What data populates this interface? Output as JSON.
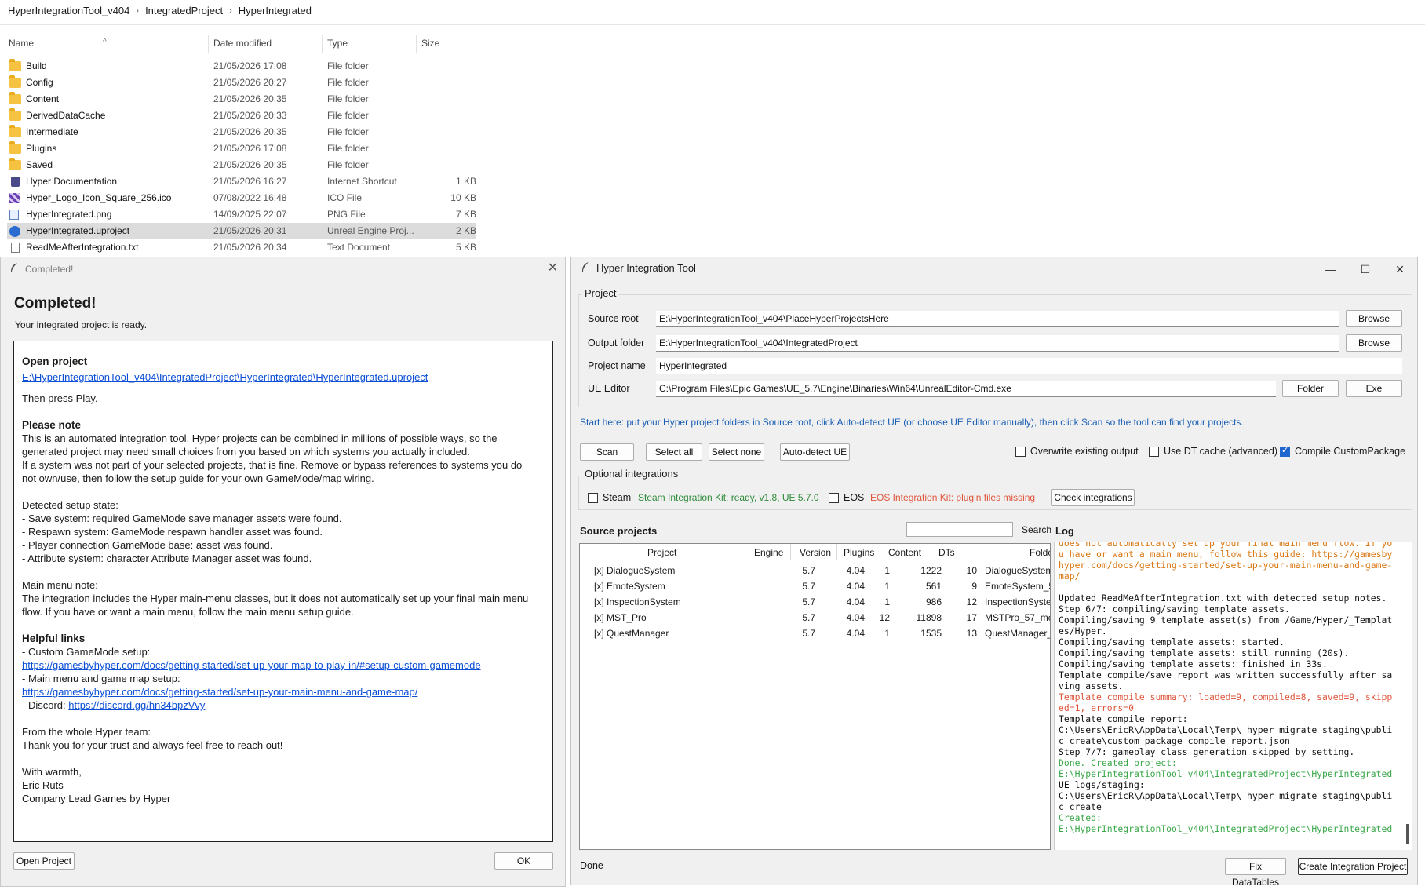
{
  "explorer": {
    "breadcrumb": [
      "HyperIntegrationTool_v404",
      "IntegratedProject",
      "HyperIntegrated"
    ],
    "columns": {
      "name": "Name",
      "date": "Date modified",
      "type": "Type",
      "size": "Size"
    },
    "files": [
      {
        "name": "Build",
        "date": "21/05/2026 17:08",
        "type": "File folder",
        "size": "",
        "icon": "folder-icon"
      },
      {
        "name": "Config",
        "date": "21/05/2026 20:27",
        "type": "File folder",
        "size": "",
        "icon": "folder-icon"
      },
      {
        "name": "Content",
        "date": "21/05/2026 20:35",
        "type": "File folder",
        "size": "",
        "icon": "folder-icon"
      },
      {
        "name": "DerivedDataCache",
        "date": "21/05/2026 20:33",
        "type": "File folder",
        "size": "",
        "icon": "folder-icon"
      },
      {
        "name": "Intermediate",
        "date": "21/05/2026 20:35",
        "type": "File folder",
        "size": "",
        "icon": "folder-icon"
      },
      {
        "name": "Plugins",
        "date": "21/05/2026 17:08",
        "type": "File folder",
        "size": "",
        "icon": "folder-icon"
      },
      {
        "name": "Saved",
        "date": "21/05/2026 20:35",
        "type": "File folder",
        "size": "",
        "icon": "folder-icon"
      },
      {
        "name": "Hyper Documentation",
        "date": "21/05/2026 16:27",
        "type": "Internet Shortcut",
        "size": "1 KB",
        "icon": "shortcut-icon"
      },
      {
        "name": "Hyper_Logo_Icon_Square_256.ico",
        "date": "07/08/2022 16:48",
        "type": "ICO File",
        "size": "10 KB",
        "icon": "ico-file-icon"
      },
      {
        "name": "HyperIntegrated.png",
        "date": "14/09/2025 22:07",
        "type": "PNG File",
        "size": "7 KB",
        "icon": "image-file-icon"
      },
      {
        "name": "HyperIntegrated.uproject",
        "date": "21/05/2026 20:31",
        "type": "Unreal Engine Proj...",
        "size": "2 KB",
        "icon": "unreal-project-icon"
      },
      {
        "name": "ReadMeAfterIntegration.txt",
        "date": "21/05/2026 20:34",
        "type": "Text Document",
        "size": "5 KB",
        "icon": "text-file-icon"
      }
    ]
  },
  "dialog": {
    "title": "Completed!",
    "heading": "Completed!",
    "subtitle": "Your integrated project is ready.",
    "open_project_heading": "Open project",
    "project_link": "E:\\HyperIntegrationTool_v404\\IntegratedProject\\HyperIntegrated\\HyperIntegrated.uproject",
    "then_press": "Then press Play.",
    "note_heading": "Please note",
    "note_lines": [
      "This is an automated integration tool. Hyper projects can be combined in millions of possible ways, so the",
      "generated project may need small choices from you based on which systems you actually included.",
      "If a system was not part of your selected projects, that is fine. Remove or bypass references to systems you do",
      "not own/use, then follow the setup guide for your own GameMode/map wiring."
    ],
    "detected_heading": "Detected setup state:",
    "detected_lines": [
      "- Save system: required GameMode save manager assets were found.",
      "- Respawn system: GameMode respawn handler asset was found.",
      "- Player connection GameMode base: asset was found.",
      "- Attribute system: character Attribute Manager asset was found."
    ],
    "menu_heading": "Main menu note:",
    "menu_lines": [
      "The integration includes the Hyper main-menu classes, but it does not automatically set up your final main menu",
      "flow. If you have or want a main menu, follow the main menu setup guide."
    ],
    "links_heading": "Helpful links",
    "link1_label": "- Custom GameMode setup:",
    "link1": "https://gamesbyhyper.com/docs/getting-started/set-up-your-map-to-play-in/#setup-custom-gamemode",
    "link2_label": "- Main menu and game map setup:",
    "link2": "https://gamesbyhyper.com/docs/getting-started/set-up-your-main-menu-and-game-map/",
    "discord_label": "- Discord: ",
    "discord": "https://discord.gg/hn34bpzVvy",
    "team_lines": [
      "From the whole Hyper team:",
      "Thank you for your trust and always feel free to reach out!"
    ],
    "sign_lines": [
      "With warmth,",
      "Eric Ruts",
      "Company Lead Games by Hyper"
    ],
    "open_button": "Open Project",
    "ok_button": "OK"
  },
  "tool": {
    "title": "Hyper Integration Tool",
    "project_group": "Project",
    "source_root_label": "Source root",
    "source_root": "E:\\HyperIntegrationTool_v404\\PlaceHyperProjectsHere",
    "output_folder_label": "Output folder",
    "output_folder": "E:\\HyperIntegrationTool_v404\\IntegratedProject",
    "project_name_label": "Project name",
    "project_name": "HyperIntegrated",
    "ue_editor_label": "UE Editor",
    "ue_editor": "C:\\Program Files\\Epic Games\\UE_5.7\\Engine\\Binaries\\Win64\\UnrealEditor-Cmd.exe",
    "browse": "Browse",
    "folder": "Folder",
    "exe": "Exe",
    "hint": "Start here: put your Hyper project folders in Source root, click Auto-detect UE (or choose UE Editor manually), then click Scan so the tool can find your projects.",
    "scan": "Scan",
    "select_all": "Select all",
    "select_none": "Select none",
    "auto_detect": "Auto-detect UE",
    "overwrite": "Overwrite existing output",
    "use_dt_cache": "Use DT cache (advanced)",
    "compile_custom": "Compile CustomPackage",
    "optional_group": "Optional integrations",
    "steam": "Steam",
    "steam_status": "Steam Integration Kit: ready, v1.8, UE 5.7.0",
    "eos": "EOS",
    "eos_status": "EOS Integration Kit: plugin files missing",
    "check_integrations": "Check integrations",
    "source_projects": "Source projects",
    "search": "Search",
    "columns": [
      "Project",
      "Engine",
      "Version",
      "Plugins",
      "Content",
      "DTs",
      "Folde"
    ],
    "rows": [
      [
        "[x] DialogueSystem",
        "5.7",
        "4.04",
        "1",
        "1222",
        "10",
        "DialogueSystem"
      ],
      [
        "[x] EmoteSystem",
        "5.7",
        "4.04",
        "1",
        "561",
        "9",
        "EmoteSystem_5"
      ],
      [
        "[x] InspectionSystem",
        "5.7",
        "4.04",
        "1",
        "986",
        "12",
        "InspectionSyster"
      ],
      [
        "[x] MST_Pro",
        "5.7",
        "4.04",
        "12",
        "11898",
        "17",
        "MSTPro_57_mec"
      ],
      [
        "[x] QuestManager",
        "5.7",
        "4.04",
        "1",
        "1535",
        "13",
        "QuestManager_"
      ]
    ],
    "log_title": "Log",
    "log": [
      {
        "c": "orange",
        "t": "does not automatically set up your final main menu flow. If you have or want a main menu, follow this guide: https://gamesbyhyper.com/docs/getting-started/set-up-your-main-menu-and-game-map/"
      },
      {
        "c": "dark",
        "t": " "
      },
      {
        "c": "dark",
        "t": "Updated ReadMeAfterIntegration.txt with detected setup notes."
      },
      {
        "c": "dark",
        "t": "Step 6/7: compiling/saving template assets."
      },
      {
        "c": "dark",
        "t": "Compiling/saving 9 template asset(s) from /Game/Hyper/_Templates/Hyper."
      },
      {
        "c": "dark",
        "t": "Compiling/saving template assets: started."
      },
      {
        "c": "dark",
        "t": "Compiling/saving template assets: still running (20s)."
      },
      {
        "c": "dark",
        "t": "Compiling/saving template assets: finished in 33s."
      },
      {
        "c": "dark",
        "t": "Template compile/save report was written successfully after saving assets."
      },
      {
        "c": "red",
        "t": "Template compile summary: loaded=9, compiled=8, saved=9, skipped=1, errors=0"
      },
      {
        "c": "dark",
        "t": "Template compile report:"
      },
      {
        "c": "dark",
        "t": "C:\\Users\\EricR\\AppData\\Local\\Temp\\_hyper_migrate_staging\\public_create\\custom_package_compile_report.json"
      },
      {
        "c": "dark",
        "t": "Step 7/7: gameplay class generation skipped by setting."
      },
      {
        "c": "green",
        "t": "Done. Created project:"
      },
      {
        "c": "green",
        "t": "E:\\HyperIntegrationTool_v404\\IntegratedProject\\HyperIntegrated"
      },
      {
        "c": "dark",
        "t": "UE logs/staging:"
      },
      {
        "c": "dark",
        "t": "C:\\Users\\EricR\\AppData\\Local\\Temp\\_hyper_migrate_staging\\public_create"
      },
      {
        "c": "green",
        "t": "Created:"
      },
      {
        "c": "green",
        "t": "E:\\HyperIntegrationTool_v404\\IntegratedProject\\HyperIntegrated"
      }
    ],
    "status": "Done",
    "fix_datatables": "Fix DataTables",
    "create_button": "Create Integration Project"
  }
}
